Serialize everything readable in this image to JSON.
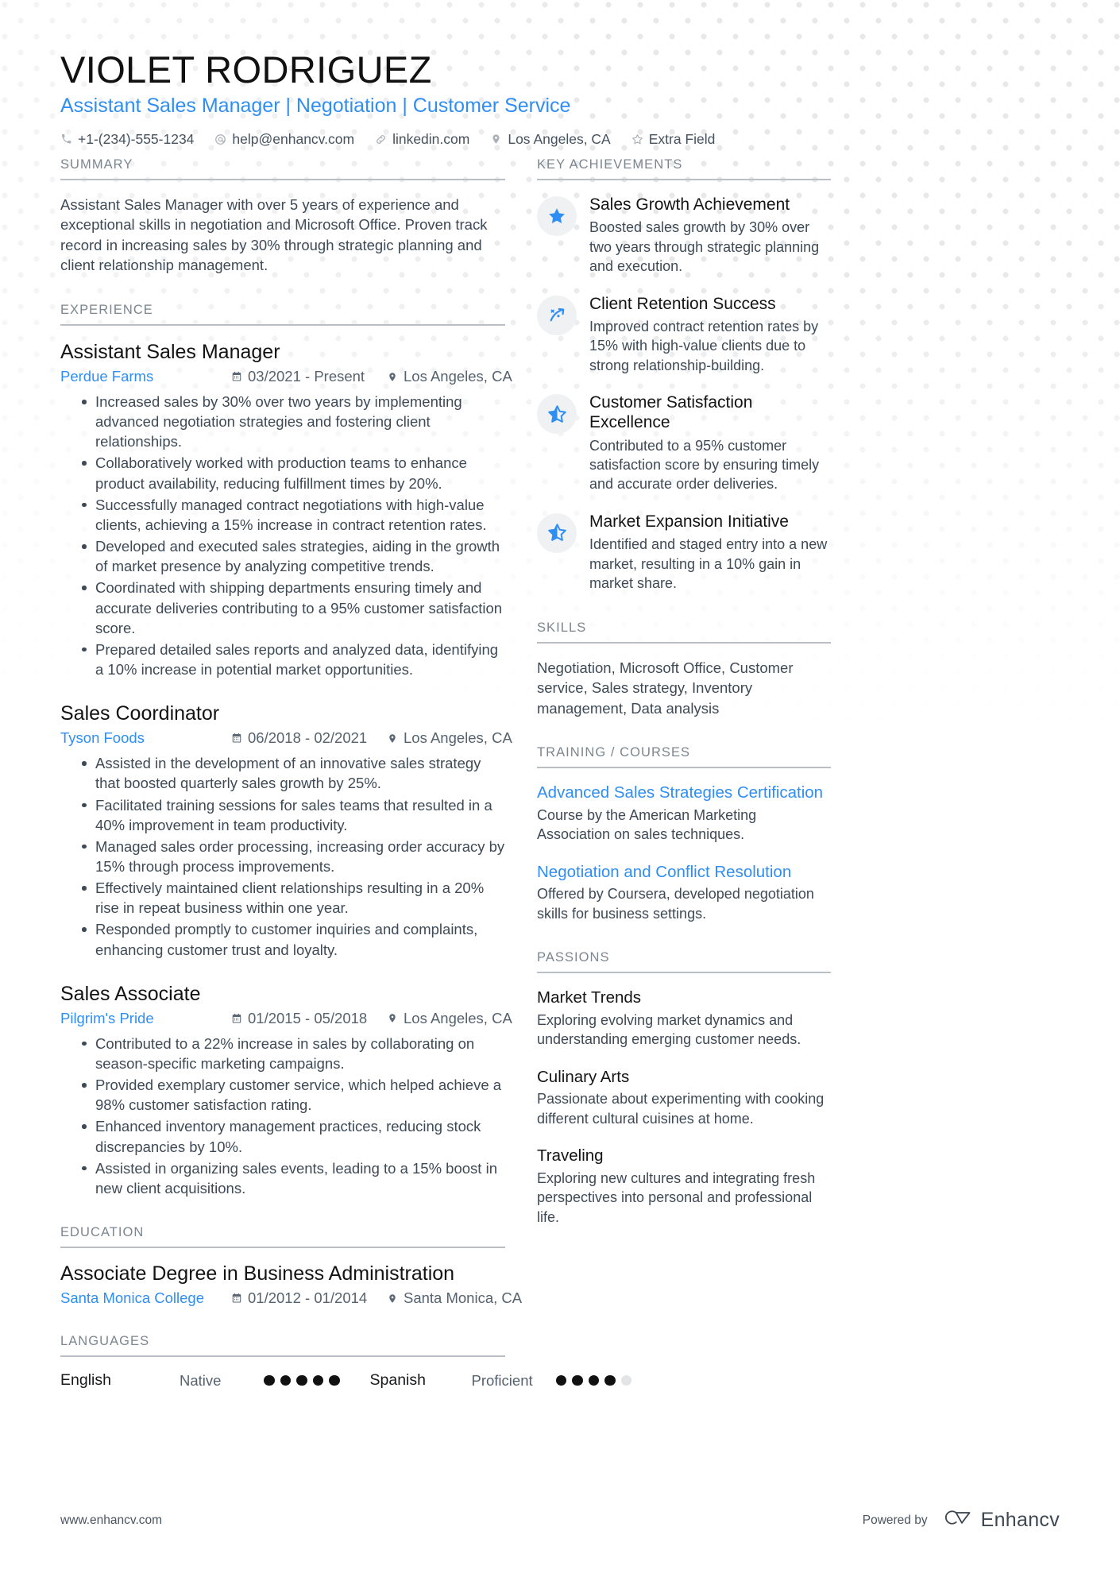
{
  "header": {
    "name": "VIOLET RODRIGUEZ",
    "headline": "Assistant Sales Manager | Negotiation | Customer Service",
    "contacts": [
      {
        "icon": "phone-icon",
        "text": "+1-(234)-555-1234"
      },
      {
        "icon": "email-icon",
        "text": "help@enhancv.com"
      },
      {
        "icon": "link-icon",
        "text": "linkedin.com"
      },
      {
        "icon": "location-pin-icon",
        "text": "Los Angeles, CA"
      },
      {
        "icon": "star-outline-icon",
        "text": "Extra Field"
      }
    ]
  },
  "summary": {
    "title": "SUMMARY",
    "text": "Assistant Sales Manager with over 5 years of experience and exceptional skills in negotiation and Microsoft Office. Proven track record in increasing sales by 30% through strategic planning and client relationship management."
  },
  "experience": {
    "title": "EXPERIENCE",
    "jobs": [
      {
        "position": "Assistant Sales Manager",
        "company": "Perdue Farms",
        "dates": "03/2021 - Present",
        "location": "Los Angeles, CA",
        "bullets": [
          "Increased sales by 30% over two years by implementing advanced negotiation strategies and fostering client relationships.",
          "Collaboratively worked with production teams to enhance product availability, reducing fulfillment times by 20%.",
          "Successfully managed contract negotiations with high-value clients, achieving a 15% increase in contract retention rates.",
          "Developed and executed sales strategies, aiding in the growth of market presence by analyzing competitive trends.",
          "Coordinated with shipping departments ensuring timely and accurate deliveries contributing to a 95% customer satisfaction score.",
          "Prepared detailed sales reports and analyzed data, identifying a 10% increase in potential market opportunities."
        ]
      },
      {
        "position": "Sales Coordinator",
        "company": "Tyson Foods",
        "dates": "06/2018 - 02/2021",
        "location": "Los Angeles, CA",
        "bullets": [
          "Assisted in the development of an innovative sales strategy that boosted quarterly sales growth by 25%.",
          "Facilitated training sessions for sales teams that resulted in a 40% improvement in team productivity.",
          "Managed sales order processing, increasing order accuracy by 15% through process improvements.",
          "Effectively maintained client relationships resulting in a 20% rise in repeat business within one year.",
          "Responded promptly to customer inquiries and complaints, enhancing customer trust and loyalty."
        ]
      },
      {
        "position": "Sales Associate",
        "company": "Pilgrim's Pride",
        "dates": "01/2015 - 05/2018",
        "location": "Los Angeles, CA",
        "bullets": [
          "Contributed to a 22% increase in sales by collaborating on season-specific marketing campaigns.",
          "Provided exemplary customer service, which helped achieve a 98% customer satisfaction rating.",
          "Enhanced inventory management practices, reducing stock discrepancies by 10%.",
          "Assisted in organizing sales events, leading to a 15% boost in new client acquisitions."
        ]
      }
    ]
  },
  "education": {
    "title": "EDUCATION",
    "degree": "Associate Degree in Business Administration",
    "school": "Santa Monica College",
    "dates": "01/2012 - 01/2014",
    "location": "Santa Monica, CA"
  },
  "languages": {
    "title": "LANGUAGES",
    "items": [
      {
        "name": "English",
        "level": "Native",
        "filled": 5,
        "total": 5
      },
      {
        "name": "Spanish",
        "level": "Proficient",
        "filled": 4,
        "total": 5
      }
    ]
  },
  "key_achievements": {
    "title": "KEY ACHIEVEMENTS",
    "items": [
      {
        "icon": "star-filled-icon",
        "title": "Sales Growth Achievement",
        "desc": "Boosted sales growth by 30% over two years through strategic planning and execution."
      },
      {
        "icon": "trending-arrow-icon",
        "title": "Client Retention Success",
        "desc": "Improved contract retention rates by 15% with high-value clients due to strong relationship-building."
      },
      {
        "icon": "star-half-icon",
        "title": "Customer Satisfaction Excellence",
        "desc": "Contributed to a 95% customer satisfaction score by ensuring timely and accurate order deliveries."
      },
      {
        "icon": "star-half-icon",
        "title": "Market Expansion Initiative",
        "desc": "Identified and staged entry into a new market, resulting in a 10% gain in market share."
      }
    ]
  },
  "skills": {
    "title": "SKILLS",
    "text": "Negotiation, Microsoft Office, Customer service, Sales strategy, Inventory management, Data analysis"
  },
  "training": {
    "title": "TRAINING / COURSES",
    "items": [
      {
        "title": "Advanced Sales Strategies Certification",
        "desc": "Course by the American Marketing Association on sales techniques."
      },
      {
        "title": "Negotiation and Conflict Resolution",
        "desc": "Offered by Coursera, developed negotiation skills for business settings."
      }
    ]
  },
  "passions": {
    "title": "PASSIONS",
    "items": [
      {
        "title": "Market Trends",
        "desc": "Exploring evolving market dynamics and understanding emerging customer needs."
      },
      {
        "title": "Culinary Arts",
        "desc": "Passionate about experimenting with cooking different cultural cuisines at home."
      },
      {
        "title": "Traveling",
        "desc": "Exploring new cultures and integrating fresh perspectives into personal and professional life."
      }
    ]
  },
  "footer": {
    "website": "www.enhancv.com",
    "powered_by": "Powered by",
    "brand": "Enhancv"
  },
  "colors": {
    "accent": "#2f8ef4",
    "text": "#3e4a56",
    "heading": "#7c868f"
  }
}
